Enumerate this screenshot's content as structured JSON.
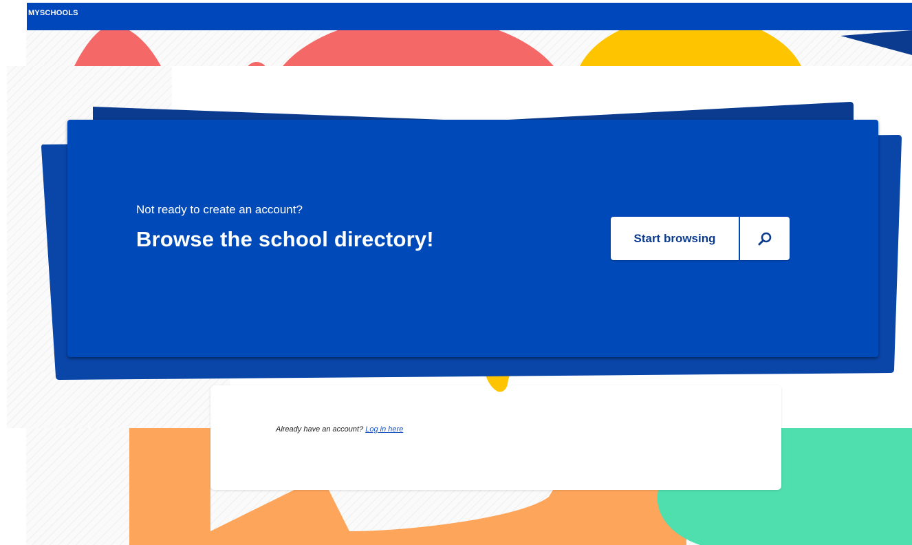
{
  "brand": "MYSCHOOLS",
  "banner": {
    "subtitle": "Not ready to create an account?",
    "headline": "Browse the school directory!",
    "browse_button_label": "Start browsing"
  },
  "login": {
    "prompt": "Already have an account?",
    "link_label": "Log in here"
  },
  "icons": {
    "search": "search-icon"
  },
  "colors": {
    "primary_blue": "#0049b8",
    "dark_blue": "#0b3b8f",
    "coral": "#f46868",
    "yellow": "#ffc400",
    "orange": "#fda55a",
    "mint": "#4fdfae"
  }
}
